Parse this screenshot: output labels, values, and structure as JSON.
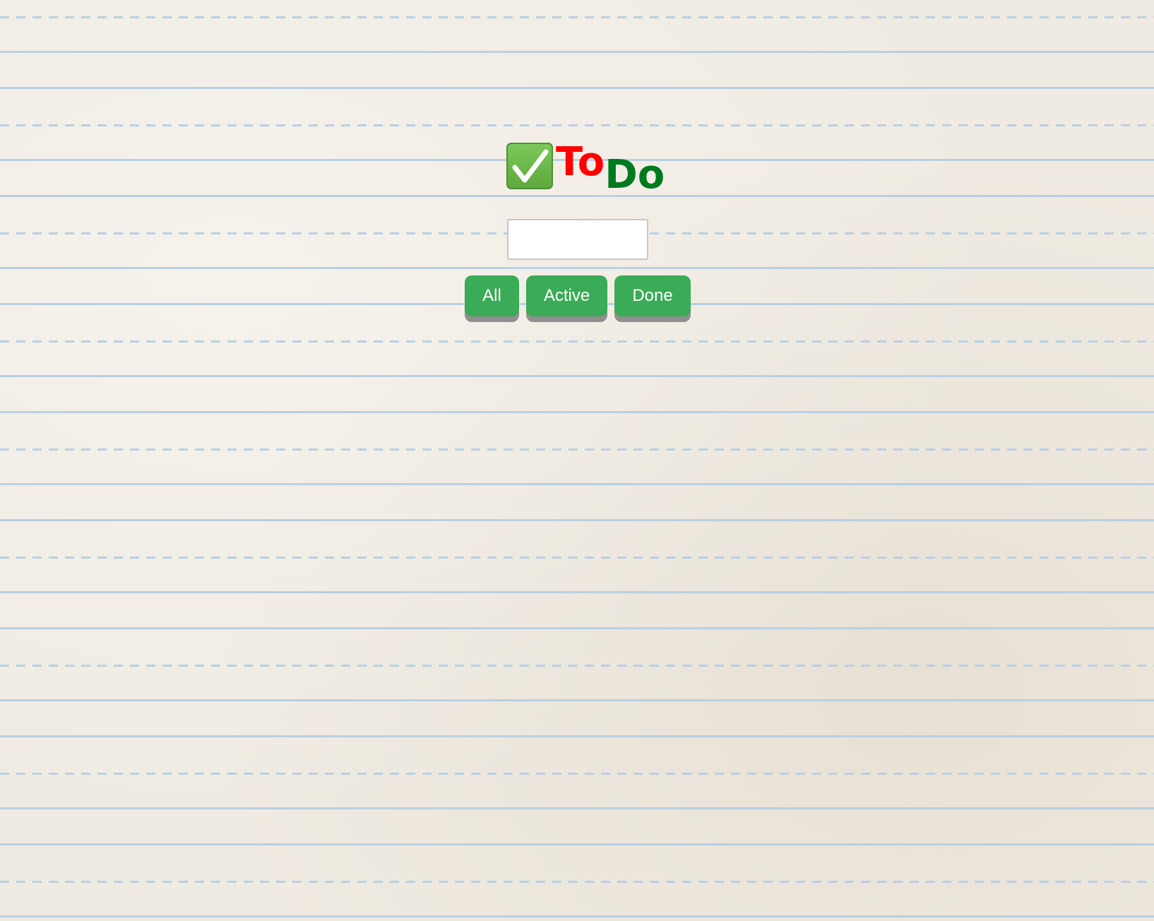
{
  "app": {
    "title_part1": "To",
    "title_part2": "Do",
    "title_icon": "check-mark-button-icon"
  },
  "input": {
    "value": "",
    "placeholder": ""
  },
  "filters": {
    "all_label": "All",
    "active_label": "Active",
    "done_label": "Done"
  },
  "colors": {
    "title_to": "#ff0000",
    "title_do": "#007a1f",
    "button_bg": "#3aab56",
    "button_text": "#ffffff",
    "ruling": "#b9cfe4",
    "paper": "#f0ebe2"
  }
}
